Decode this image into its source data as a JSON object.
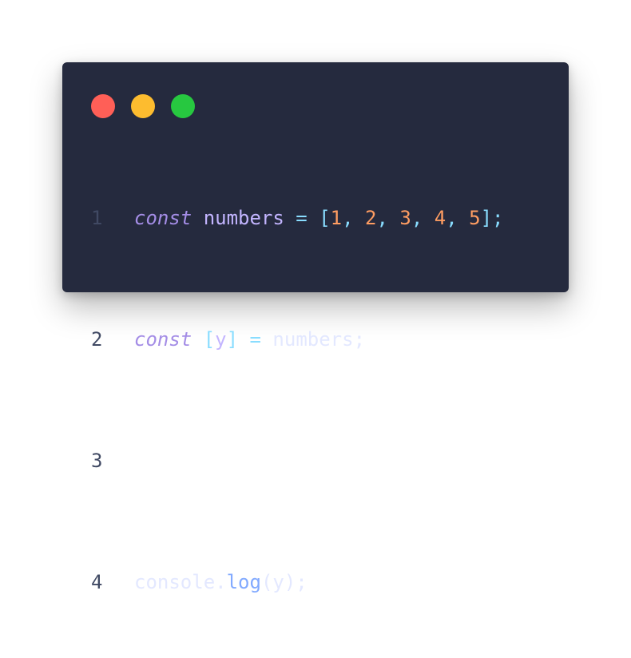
{
  "window": {
    "traffic_lights": {
      "close_color": "#ff5f57",
      "minimize_color": "#fdbc2f",
      "maximize_color": "#27c840"
    }
  },
  "code": {
    "lines": [
      {
        "number": "1",
        "tokens": {
          "t1": "const",
          "t2": " ",
          "t3": "numbers",
          "t4": " = ",
          "t5": "[",
          "t6": "1",
          "t7": ", ",
          "t8": "2",
          "t9": ", ",
          "t10": "3",
          "t11": ", ",
          "t12": "4",
          "t13": ", ",
          "t14": "5",
          "t15": "];"
        }
      },
      {
        "number": "2",
        "tokens": {
          "t1": "const",
          "t2": " ",
          "t3": "[",
          "t4": "y",
          "t5": "]",
          "t6": " = ",
          "t7": "numbers;"
        }
      },
      {
        "number": "3",
        "tokens": {}
      },
      {
        "number": "4",
        "tokens": {
          "t1": "console.",
          "t2": "log",
          "t3": "(y);"
        }
      }
    ]
  },
  "colors": {
    "background": "#252a3e",
    "line_number": "#404963",
    "keyword": "#a48de6",
    "variable": "#c3b5ff",
    "number": "#ff9d62",
    "punctuation": "#89ddff",
    "function": "#82aaff",
    "text": "#e3e8ff"
  }
}
